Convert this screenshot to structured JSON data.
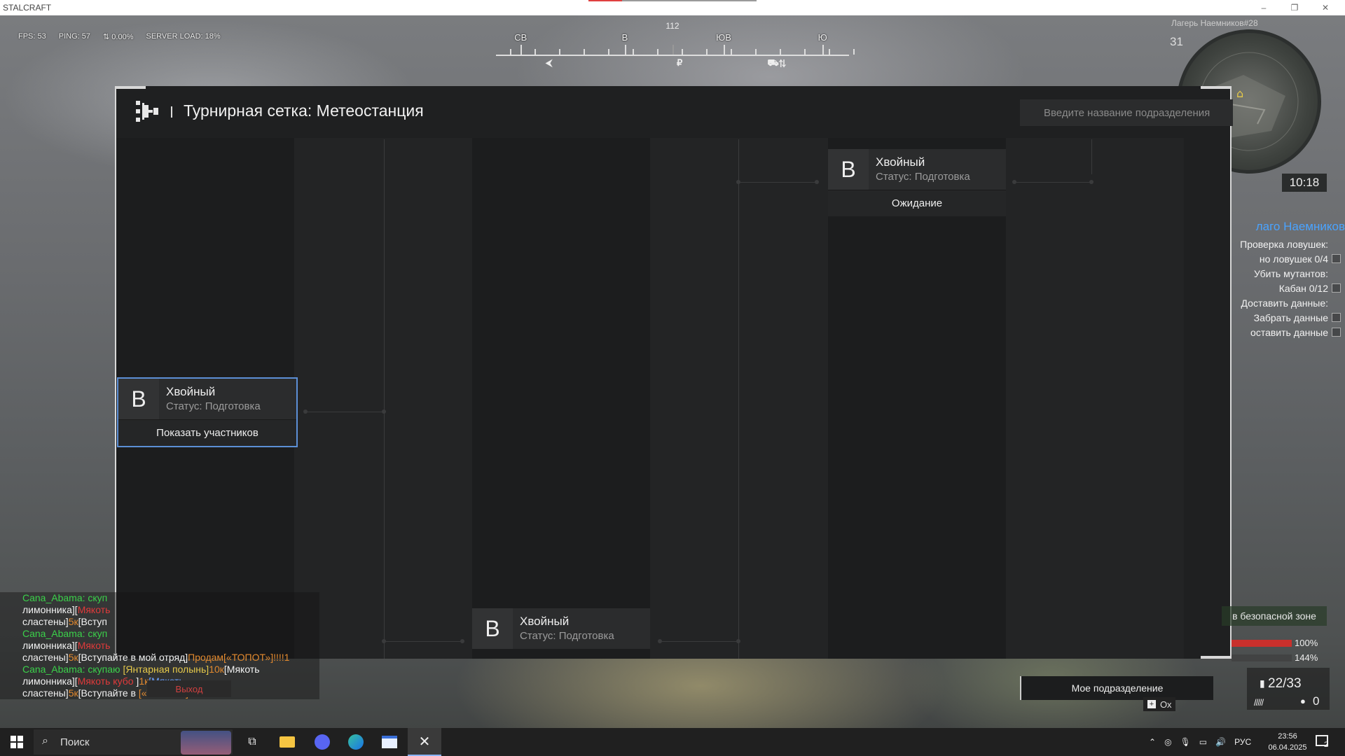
{
  "window": {
    "title": "STALCRAFT",
    "minimize": "–",
    "restore": "❐",
    "close": "✕"
  },
  "hud_stats": {
    "fps": "FPS: 53",
    "ping": "PING: 57",
    "loss": "0.00%",
    "server_load": "SERVER LOAD: 18%"
  },
  "compass": {
    "heading": "112",
    "labels": [
      {
        "text": "СВ",
        "pos": 0.07
      },
      {
        "text": "В",
        "pos": 0.365
      },
      {
        "text": "ЮВ",
        "pos": 0.645
      },
      {
        "text": "Ю",
        "pos": 0.925
      }
    ],
    "markers": [
      {
        "text": "⮜",
        "pos": 0.15
      },
      {
        "text": "₽",
        "pos": 0.52
      },
      {
        "text": "⛟⇅",
        "pos": 0.795
      }
    ]
  },
  "minimap": {
    "title": "Лагерь Наемников#28",
    "day": "31",
    "time": "10:18"
  },
  "quest": {
    "title": "лаго Наемников",
    "items": [
      {
        "text": "Проверка ловушек:",
        "box": false
      },
      {
        "text": "но ловушек 0/4",
        "box": true
      },
      {
        "text": "Убить мутантов:",
        "box": false
      },
      {
        "text": "Кабан 0/12",
        "box": true
      },
      {
        "text": "Доставить данные:",
        "box": false
      },
      {
        "text": "Забрать данные",
        "box": true
      },
      {
        "text": "оставить данные",
        "box": true
      }
    ]
  },
  "panel": {
    "title": "Турнирная сетка: Метеостанция",
    "search_placeholder": "Введите название подразделения"
  },
  "teams": [
    {
      "letter": "В",
      "name": "Хвойный",
      "status": "Статус: Подготовка",
      "action": "Показать участников"
    },
    {
      "letter": "В",
      "name": "Хвойный",
      "status": "Статус: Подготовка",
      "action": ""
    },
    {
      "letter": "В",
      "name": "Хвойный",
      "status": "Статус: Подготовка",
      "action": "Ожидание"
    }
  ],
  "chat": {
    "lines": [
      [
        {
          "t": "Cana_Abama: скуп",
          "c": "green"
        }
      ],
      [
        {
          "t": "лимонника][",
          "c": "white"
        },
        {
          "t": "Мякоть",
          "c": "red"
        }
      ],
      [
        {
          "t": "сластены]",
          "c": "white"
        },
        {
          "t": "5к",
          "c": "orange"
        },
        {
          "t": "[Вступ",
          "c": "white"
        }
      ],
      [
        {
          "t": "Cana_Abama: скуп",
          "c": "green"
        }
      ],
      [
        {
          "t": "лимонника][",
          "c": "white"
        },
        {
          "t": "Мякоть",
          "c": "red"
        }
      ],
      [
        {
          "t": "сластены]",
          "c": "white"
        },
        {
          "t": "5к",
          "c": "orange"
        },
        {
          "t": "[Вступайте в мой отряд]",
          "c": "white"
        },
        {
          "t": "Продам[«ТОПОТ»]!!!!1",
          "c": "orange"
        }
      ],
      [
        {
          "t": "Cana_Abama: скупаю ",
          "c": "green"
        },
        {
          "t": "[Янтарная полынь]",
          "c": "yellow"
        },
        {
          "t": "10к",
          "c": "orange"
        },
        {
          "t": "[Мякоть",
          "c": "white"
        }
      ],
      [
        {
          "t": "лимонника][",
          "c": "white"
        },
        {
          "t": "Мякоть кубо",
          "c": "red"
        },
        {
          "t": "      ]",
          "c": "white"
        },
        {
          "t": "1к",
          "c": "orange"
        },
        {
          "t": "[Мякоть",
          "c": "blue"
        }
      ],
      [
        {
          "t": "сластены]",
          "c": "white"
        },
        {
          "t": "5к",
          "c": "orange"
        },
        {
          "t": "[Вступайте в",
          "c": "white"
        },
        {
          "t": "              [«ТОПОТ»]!!!!1!",
          "c": "orange"
        }
      ]
    ],
    "exit_label": "Выход"
  },
  "bottom_hud": {
    "safe_zone": "в безопасной зоне",
    "hp": "100%",
    "energy": "144%",
    "hp_fraction": 1.0,
    "my_unit": "Мое подразделение",
    "key_hint": "Ох",
    "ammo": "22/33",
    "grenades": "0"
  },
  "taskbar": {
    "search_label": "Поиск",
    "lang": "РУС",
    "time": "23:56",
    "date": "06.04.2025",
    "notifications": "2"
  }
}
